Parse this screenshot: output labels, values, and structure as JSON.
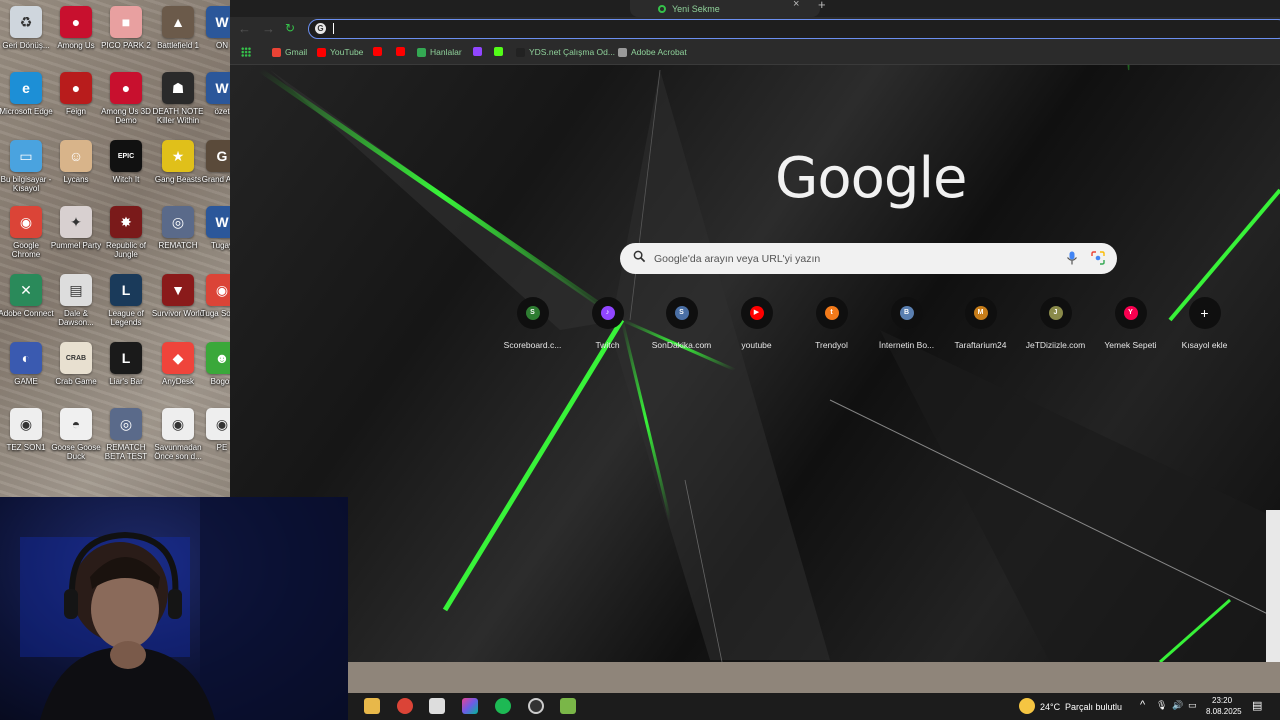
{
  "desktop": {
    "icons": [
      {
        "label": "Geri Dönüş...",
        "icon": "recycle-bin-icon",
        "color": "#cfd6dd",
        "glyph": "♻"
      },
      {
        "label": "Among Us",
        "icon": "among-us-icon",
        "color": "#c8102e",
        "glyph": "●"
      },
      {
        "label": "PICO PARK 2",
        "icon": "pico-park-icon",
        "color": "#e8a0a0",
        "glyph": "■"
      },
      {
        "label": "Battlefield 1",
        "icon": "battlefield-icon",
        "color": "#6b5a4a",
        "glyph": "▲"
      },
      {
        "label": "ON",
        "icon": "word-doc-icon",
        "color": "#2b579a",
        "glyph": "W"
      },
      {
        "label": "Microsoft Edge",
        "icon": "edge-icon",
        "color": "#1d8fd6",
        "glyph": "e"
      },
      {
        "label": "Feign",
        "icon": "feign-icon",
        "color": "#b81c1c",
        "glyph": "●"
      },
      {
        "label": "Among Us 3D Demo",
        "icon": "among-us-3d-icon",
        "color": "#c8102e",
        "glyph": "●"
      },
      {
        "label": "DEATH NOTE Killer Within",
        "icon": "death-note-icon",
        "color": "#2a2a2a",
        "glyph": "☗"
      },
      {
        "label": "özet",
        "icon": "word-doc-icon",
        "color": "#2b579a",
        "glyph": "W"
      },
      {
        "label": "Bu bilgisayar - Kısayol",
        "icon": "this-pc-icon",
        "color": "#4aa3df",
        "glyph": "▭"
      },
      {
        "label": "Lycans",
        "icon": "lycans-icon",
        "color": "#d8b48a",
        "glyph": "☺"
      },
      {
        "label": "EPIC GAMES",
        "sublabel": "Witch It",
        "icon": "epic-games-icon",
        "color": "#111111",
        "glyph": "EPIC"
      },
      {
        "label": "Gang Beasts",
        "icon": "gang-beasts-icon",
        "color": "#e0c01a",
        "glyph": "★"
      },
      {
        "label": "Grand Auto",
        "icon": "gta-icon",
        "color": "#5a4a3a",
        "glyph": "G"
      },
      {
        "label": "Google Chrome",
        "icon": "chrome-icon",
        "color": "#db4437",
        "glyph": "◉"
      },
      {
        "label": "Pummel Party",
        "icon": "pummel-party-icon",
        "color": "#d8d0d0",
        "glyph": "✦"
      },
      {
        "label": "Republic of Jungle",
        "icon": "republic-jungle-icon",
        "color": "#7a1a1a",
        "glyph": "✸"
      },
      {
        "label": "REMATCH",
        "icon": "rematch-icon",
        "color": "#5a6a8a",
        "glyph": "◎"
      },
      {
        "label": "Tugay",
        "icon": "word-doc-icon",
        "color": "#2b579a",
        "glyph": "W"
      },
      {
        "label": "Adobe Connect",
        "icon": "adobe-connect-icon",
        "color": "#2a8a5a",
        "glyph": "✕"
      },
      {
        "label": "Dale & Dawson...",
        "icon": "dale-dawson-icon",
        "color": "#dddddd",
        "glyph": "▤"
      },
      {
        "label": "League of Legends",
        "icon": "league-icon",
        "color": "#1a3a5a",
        "glyph": "L"
      },
      {
        "label": "Survivor World",
        "icon": "survivor-world-icon",
        "color": "#8a1a1a",
        "glyph": "▼"
      },
      {
        "label": "Tuga Son H",
        "icon": "chrome-icon",
        "color": "#db4437",
        "glyph": "◉"
      },
      {
        "label": "GAME",
        "icon": "game-doc-icon",
        "color": "#3a5ab0",
        "glyph": "◐"
      },
      {
        "label": "Crab Game",
        "icon": "crab-game-icon",
        "color": "#e8e0d0",
        "glyph": "CRAB"
      },
      {
        "label": "Liar's Bar",
        "icon": "liars-bar-icon",
        "color": "#1a1a1a",
        "glyph": "L"
      },
      {
        "label": "AnyDesk",
        "icon": "anydesk-icon",
        "color": "#ef443b",
        "glyph": "◆"
      },
      {
        "label": "Bogos",
        "icon": "bogos-icon",
        "color": "#3aa83a",
        "glyph": "☻"
      },
      {
        "label": "TEZ SON1",
        "icon": "chrome-doc-icon",
        "color": "#eeeeee",
        "glyph": "◉"
      },
      {
        "label": "Goose Goose Duck",
        "icon": "goose-duck-icon",
        "color": "#f0f0f0",
        "glyph": "◓"
      },
      {
        "label": "REMATCH BETA TEST",
        "icon": "rematch-beta-icon",
        "color": "#5a6a8a",
        "glyph": "◎"
      },
      {
        "label": "Savunmadan Önce son d...",
        "icon": "chrome-doc-icon",
        "color": "#eeeeee",
        "glyph": "◉"
      },
      {
        "label": "PE",
        "icon": "chrome-doc-icon",
        "color": "#eeeeee",
        "glyph": "◉"
      }
    ]
  },
  "browser": {
    "tab_title": "Yeni Sekme",
    "bookmarks": [
      {
        "label": "Gmail",
        "color": "#ea4335"
      },
      {
        "label": "YouTube",
        "color": "#ff0000"
      },
      {
        "label": "",
        "color": "#ff0000"
      },
      {
        "label": "",
        "color": "#ff0000"
      },
      {
        "label": "Hanlalar",
        "color": "#34a853"
      },
      {
        "label": "",
        "color": "#9146ff"
      },
      {
        "label": "",
        "color": "#53fc18"
      },
      {
        "label": "YDS.net Çalışma Od...",
        "color": "#222222"
      },
      {
        "label": "Adobe Acrobat",
        "color": "#999999"
      }
    ],
    "logo": "Google",
    "search_placeholder": "Google'da arayın veya URL'yi yazın",
    "shortcuts": [
      {
        "label": "Scoreboard.c...",
        "letter": "S",
        "color": "#2e7d32"
      },
      {
        "label": "Twitch",
        "letter": "♪",
        "color": "#9146ff"
      },
      {
        "label": "SonDakika.com",
        "letter": "S",
        "color": "#4a6fa5"
      },
      {
        "label": "youtube",
        "letter": "▶",
        "color": "#ff0000"
      },
      {
        "label": "Trendyol",
        "letter": "t",
        "color": "#f27a1a"
      },
      {
        "label": "İnternetin Bo...",
        "letter": "B",
        "color": "#5a7fb0"
      },
      {
        "label": "Taraftarium24",
        "letter": "M",
        "color": "#c77d1a"
      },
      {
        "label": "JeTDiziizle.com",
        "letter": "J",
        "color": "#8a8a4a"
      },
      {
        "label": "Yemek Sepeti",
        "letter": "Y",
        "color": "#fa0050"
      },
      {
        "label": "Kısayol ekle",
        "letter": "+",
        "color": "transparent"
      }
    ]
  },
  "taskbar": {
    "weather_temp": "24°C",
    "weather_desc": "Parçalı bulutlu",
    "time": "23:20",
    "date": "8.08.2025"
  }
}
